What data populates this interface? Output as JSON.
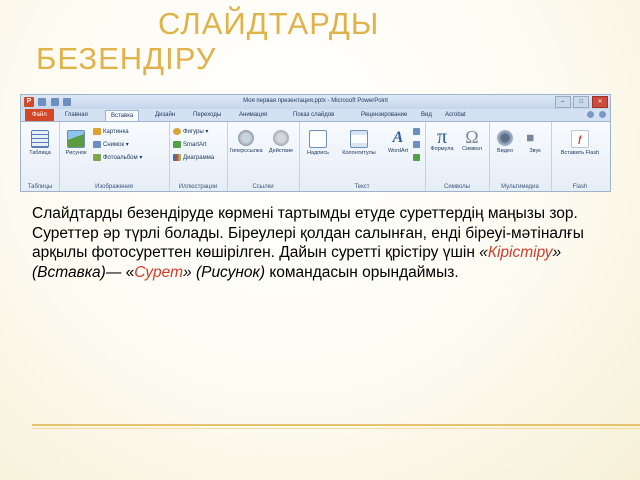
{
  "slide": {
    "title_line1": "Слайдтарды",
    "title_line2": "безендіру",
    "body": {
      "intro": "Слайдтарды безендіруде көрмені тартымды етуде суреттердің маңызы зор. Суреттер әр түрлі болады. Біреулері қолдан салынған, енді біреуі-мәтіналғы арқылы фотосуреттен көшірілген. Дайын суретті қрістіру үшін ",
      "q1_open": "«",
      "q1_word": "Кірістіру",
      "q1_close": "»",
      "q1_paren": " (Вставка)",
      "dash": "— «",
      "q2_word": "Сурет",
      "q2_close": "» ",
      "q2_paren": "(Рисунок)",
      "outro": " командасын орындаймыз."
    }
  },
  "powerpoint": {
    "window_title": "Моя первая презентация.pptx - Microsoft PowerPoint",
    "window_buttons": {
      "minimize": "–",
      "maximize": "□",
      "close": "✕"
    },
    "tabs": [
      "Файл",
      "Главная",
      "Вставка",
      "Дизайн",
      "Переходы",
      "Анимация",
      "Показ слайдов",
      "Рецензирование",
      "Вид",
      "Acrobat"
    ],
    "groups": {
      "tables": {
        "label": "Таблицы",
        "button": "Таблица"
      },
      "images": {
        "label": "Изображения",
        "big": "Рисунок",
        "small": [
          "Картинка",
          "Снимок",
          "Фотоальбом"
        ]
      },
      "illustrations": {
        "label": "Иллюстрации",
        "small": [
          "Фигуры",
          "SmartArt",
          "Диаграмма"
        ]
      },
      "links": {
        "label": "Ссылки",
        "big": [
          "Гиперссылка",
          "Действие"
        ]
      },
      "text": {
        "label": "Текст",
        "big": [
          "Надпись",
          "Колонтитулы",
          "WordArt"
        ]
      },
      "symbols": {
        "label": "Символы",
        "big": [
          "Формула",
          "Символ"
        ]
      },
      "multimedia": {
        "label": "Мультимедиа",
        "big": [
          "Видео",
          "Звук"
        ]
      },
      "flash": {
        "label": "Flash",
        "big": "Вставить Flash"
      }
    }
  },
  "colors": {
    "title": "#e0b24a",
    "accent_red": "#d23b2a",
    "file_tab": "#d24726",
    "rule": "#e6c46e"
  }
}
